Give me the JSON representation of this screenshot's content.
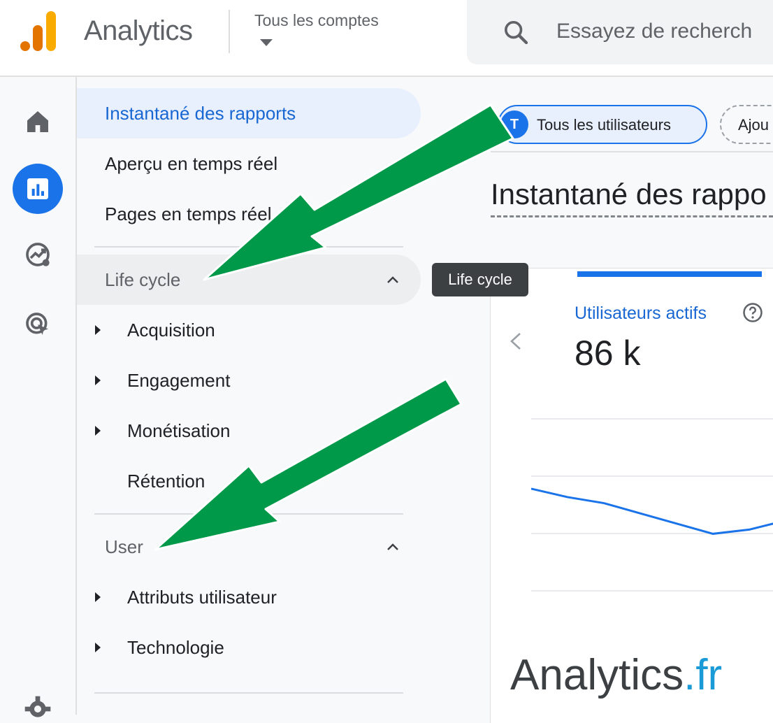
{
  "header": {
    "app_title": "Analytics",
    "account_label": "Tous les comptes",
    "search_placeholder": "Essayez de recherch"
  },
  "rail": {
    "items": [
      "home-icon",
      "reports-icon",
      "explore-icon",
      "advertising-icon"
    ],
    "active_index": 1,
    "footer_icon": "gear-icon"
  },
  "nav": {
    "items": [
      {
        "label": "Instantané des rapports",
        "active": true
      },
      {
        "label": "Aperçu en temps réel"
      },
      {
        "label": "Pages en temps réel"
      }
    ],
    "sections": [
      {
        "title": "Life cycle",
        "expanded": true,
        "items": [
          {
            "label": "Acquisition",
            "has_children": true
          },
          {
            "label": "Engagement",
            "has_children": true
          },
          {
            "label": "Monétisation",
            "has_children": true
          },
          {
            "label": "Rétention",
            "has_children": false
          }
        ]
      },
      {
        "title": "User",
        "expanded": true,
        "items": [
          {
            "label": "Attributs utilisateur",
            "has_children": true
          },
          {
            "label": "Technologie",
            "has_children": true
          }
        ]
      }
    ]
  },
  "tooltip": {
    "text": "Life cycle"
  },
  "main": {
    "segment_chip": {
      "avatar": "T",
      "label": "Tous les utilisateurs"
    },
    "add_chip": {
      "label": "Ajou"
    },
    "page_title": "Instantané des rappo",
    "card": {
      "metric_label": "Utilisateurs actifs",
      "metric_value": "86 k"
    }
  },
  "watermark": {
    "main": "Analytics",
    "accent": ".fr"
  },
  "colors": {
    "accent": "#1a73e8",
    "active_nav_bg": "#e8f0fe",
    "arrow_green": "#00994a",
    "logo_orange": "#f9ab00",
    "logo_dark_orange": "#e37400"
  },
  "chart_data": {
    "type": "line",
    "title": "",
    "xlabel": "",
    "ylabel": "",
    "x": [
      0,
      1,
      2,
      3,
      4,
      5,
      6,
      7
    ],
    "series": [
      {
        "values": [
          0.78,
          0.64,
          0.54,
          0.37,
          0.2,
          0.03,
          0.1,
          0.25
        ]
      }
    ],
    "ylim": [
      0,
      1
    ],
    "grid": true,
    "legend": "none"
  }
}
